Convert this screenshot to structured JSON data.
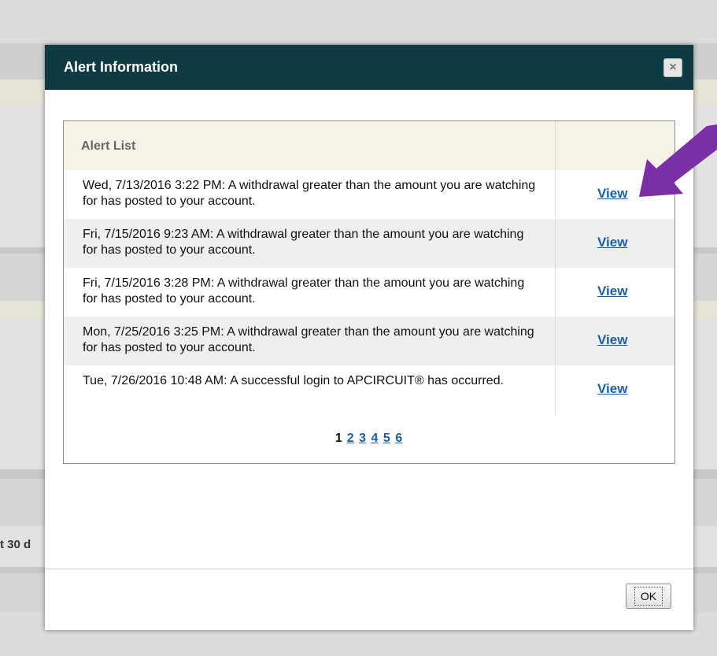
{
  "background": {
    "partial_text": "t 30 d"
  },
  "modal": {
    "title": "Alert Information",
    "close_label": "×",
    "list_title": "Alert List",
    "alerts": [
      {
        "text": "Wed, 7/13/2016 3:22 PM: A withdrawal greater than the amount you are watching for has posted to your account.",
        "link": "View"
      },
      {
        "text": "Fri, 7/15/2016 9:23 AM: A withdrawal greater than the amount you are watching for has posted to your account.",
        "link": "View"
      },
      {
        "text": "Fri, 7/15/2016 3:28 PM: A withdrawal greater than the amount you are watching for has posted to your account.",
        "link": "View"
      },
      {
        "text": "Mon, 7/25/2016 3:25 PM: A withdrawal greater than the amount you are watching for has posted to your account.",
        "link": "View"
      },
      {
        "text": "Tue, 7/26/2016 10:48 AM: A successful login to APCIRCUIT® has occurred.",
        "link": "View"
      }
    ],
    "pagination": {
      "current": "1",
      "pages": [
        "2",
        "3",
        "4",
        "5",
        "6"
      ]
    },
    "ok_label": "OK"
  },
  "colors": {
    "header_bg": "#0e3a44",
    "link": "#1b5fa8",
    "annotation_arrow": "#7b2fa6"
  }
}
